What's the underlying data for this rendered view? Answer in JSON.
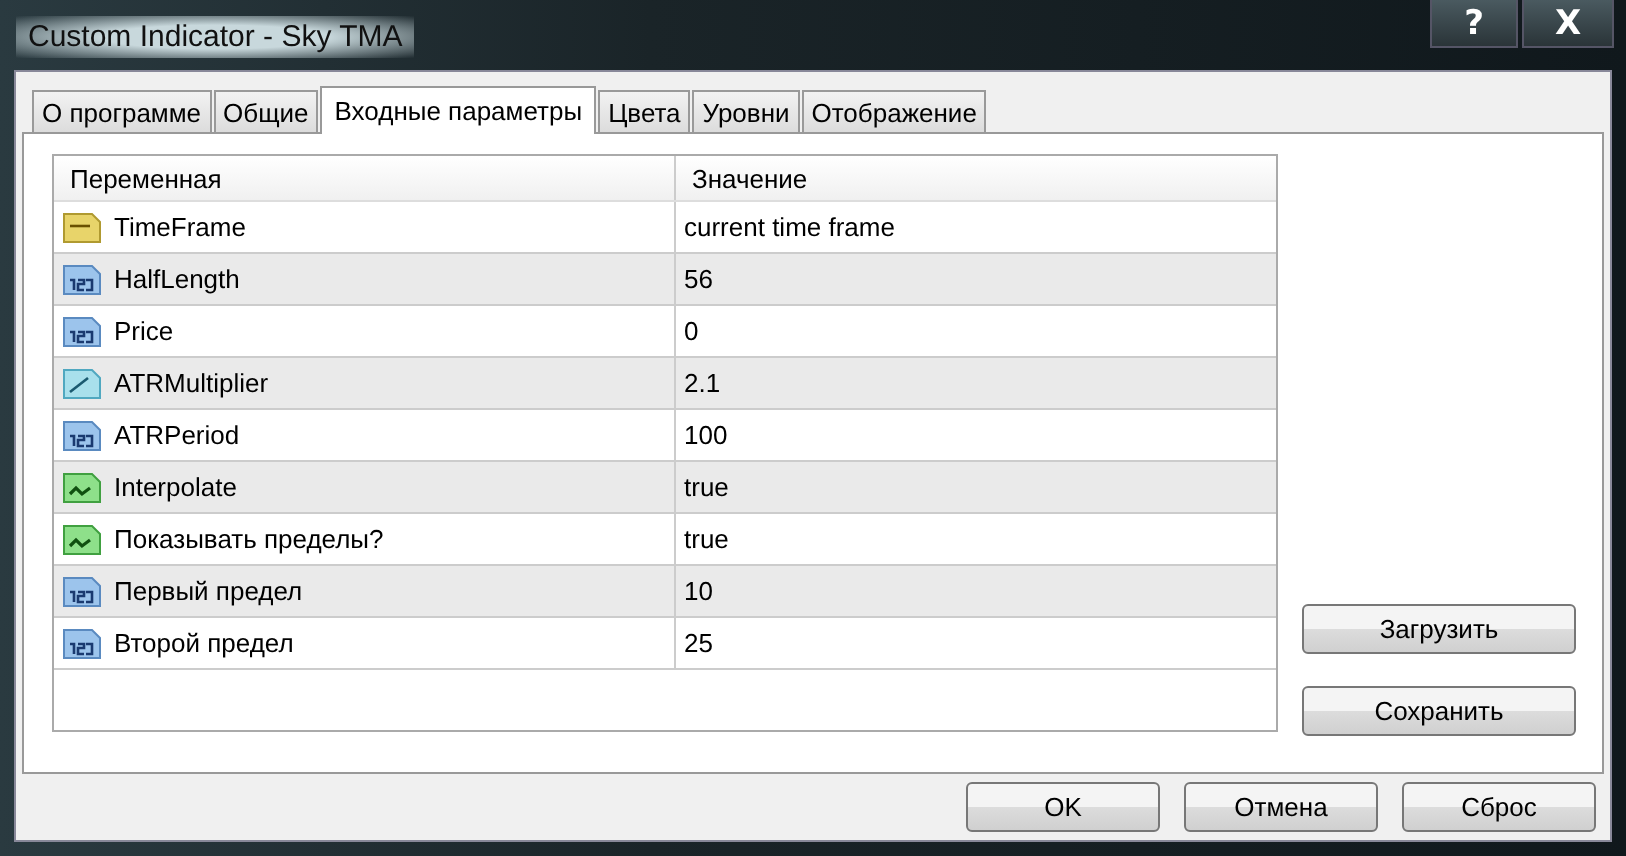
{
  "window": {
    "title": "Custom Indicator - Sky TMA",
    "title_buttons": [
      "?",
      "X"
    ]
  },
  "tabs": [
    {
      "label": "О программе",
      "selected": false
    },
    {
      "label": "Общие",
      "selected": false
    },
    {
      "label": "Входные параметры",
      "selected": true
    },
    {
      "label": "Цвета",
      "selected": false
    },
    {
      "label": "Уровни",
      "selected": false
    },
    {
      "label": "Отображение",
      "selected": false
    }
  ],
  "table": {
    "columns": [
      "Переменная",
      "Значение"
    ],
    "rows": [
      {
        "kind": "string",
        "name": "TimeFrame",
        "value": "current time frame"
      },
      {
        "kind": "integer",
        "name": "HalfLength",
        "value": "56"
      },
      {
        "kind": "integer",
        "name": "Price",
        "value": "0"
      },
      {
        "kind": "double",
        "name": "ATRMultiplier",
        "value": "2.1"
      },
      {
        "kind": "integer",
        "name": "ATRPeriod",
        "value": "100"
      },
      {
        "kind": "bool",
        "name": "Interpolate",
        "value": "true"
      },
      {
        "kind": "bool",
        "name": "Показывать пределы?",
        "value": "true"
      },
      {
        "kind": "integer",
        "name": "Первый предел",
        "value": "10"
      },
      {
        "kind": "integer",
        "name": "Второй предел",
        "value": "25"
      }
    ]
  },
  "side_buttons": [
    "Загрузить",
    "Сохранить"
  ],
  "buttons": [
    "OK",
    "Отмена",
    "Сброс"
  ]
}
